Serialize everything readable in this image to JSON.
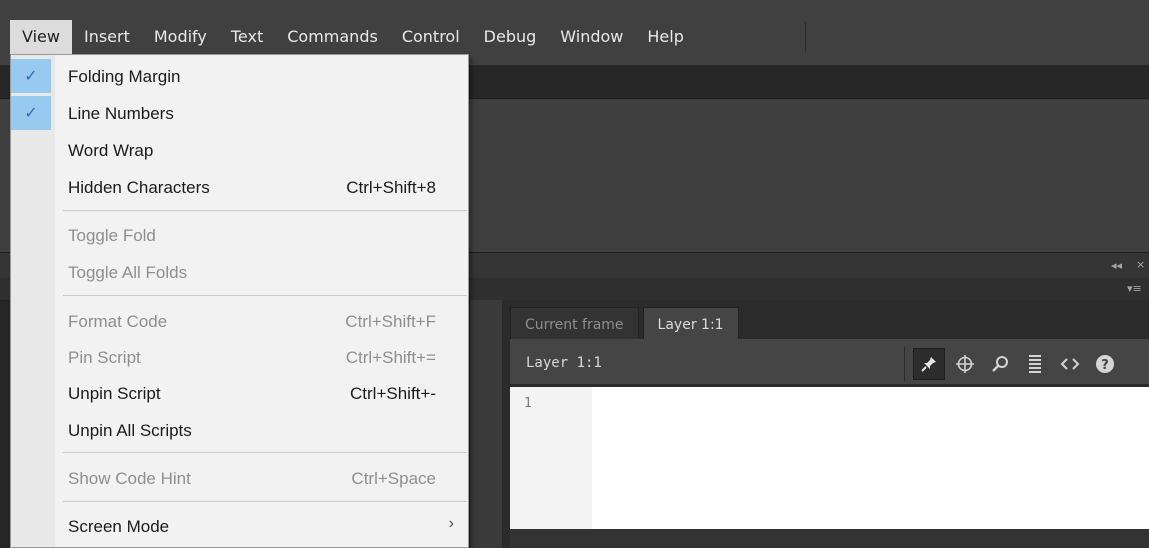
{
  "menubar": {
    "items": [
      "View",
      "Insert",
      "Modify",
      "Text",
      "Commands",
      "Control",
      "Debug",
      "Window",
      "Help"
    ],
    "active_item": "View"
  },
  "panel": {
    "collapse_glyph": "◂◂",
    "close_glyph": "×",
    "options_glyph": "▾≡"
  },
  "view_menu": {
    "items": [
      {
        "label": "Folding Margin",
        "checked": true
      },
      {
        "label": "Line Numbers",
        "checked": true
      },
      {
        "label": "Word Wrap"
      },
      {
        "label": "Hidden Characters",
        "shortcut": "Ctrl+Shift+8"
      },
      {
        "label": "Toggle Fold",
        "disabled": true
      },
      {
        "label": "Toggle All Folds",
        "disabled": true
      },
      {
        "label": "Format Code",
        "shortcut": "Ctrl+Shift+F",
        "disabled": true
      },
      {
        "label": "Pin Script",
        "shortcut": "Ctrl+Shift+=",
        "disabled": true
      },
      {
        "label": "Unpin Script",
        "shortcut": "Ctrl+Shift+-"
      },
      {
        "label": "Unpin All Scripts"
      },
      {
        "label": "Show Code Hint",
        "shortcut": "Ctrl+Space",
        "disabled": true
      },
      {
        "label": "Screen Mode",
        "submenu": true
      }
    ],
    "check_glyph": "✓",
    "submenu_glyph": "›"
  },
  "actions_panel": {
    "tabs": [
      {
        "label": "Current frame",
        "active": false
      },
      {
        "label": "Layer 1:1",
        "active": true
      }
    ],
    "script_title": "Layer 1:1",
    "toolbar_icons": [
      {
        "name": "pin-icon",
        "glyph": "📌"
      },
      {
        "name": "target-icon",
        "glyph": "⊕"
      },
      {
        "name": "search-icon",
        "glyph": "⌕"
      },
      {
        "name": "format-icon",
        "glyph": "≣"
      },
      {
        "name": "code-snippets-icon",
        "glyph": "‹›"
      },
      {
        "name": "help-icon",
        "glyph": "?"
      }
    ],
    "line_numbers": [
      "1"
    ]
  }
}
